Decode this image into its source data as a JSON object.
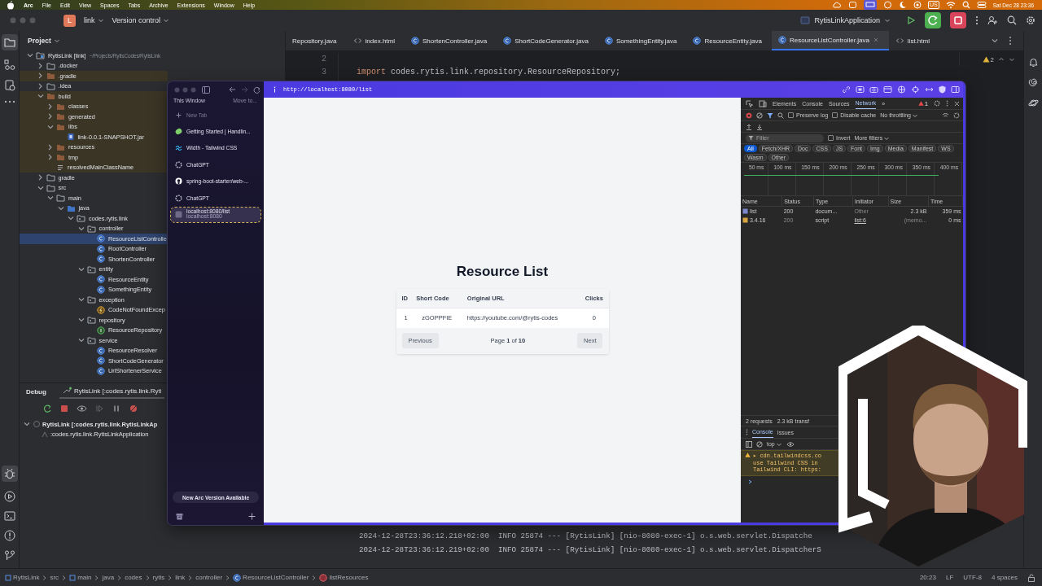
{
  "menu_bar": {
    "app": "Arc",
    "items": [
      "File",
      "Edit",
      "View",
      "Spaces",
      "Tabs",
      "Archive",
      "Extensions",
      "Window",
      "Help"
    ],
    "input_source": "US",
    "clock": "Sat Dec 28  23:36"
  },
  "ide_toolbar": {
    "project_badge": "L",
    "project": "link",
    "vcs": "Version control",
    "run_config": "RytisLinkApplication"
  },
  "project_panel": {
    "title": "Project",
    "tree": [
      {
        "label": "RytisLink [link]",
        "hint": "~/Projects/RytisCodes/RytisLink",
        "kind": "module",
        "expanded": true,
        "selected": false,
        "children": [
          {
            "label": ".docker",
            "kind": "folder",
            "expanded": false,
            "selected": false
          },
          {
            "label": ".gradle",
            "kind": "excluded-folder",
            "expanded": false,
            "selected": false
          },
          {
            "label": ".idea",
            "kind": "folder",
            "expanded": false,
            "selected": false
          },
          {
            "label": "build",
            "kind": "excluded-folder",
            "expanded": true,
            "selected": false,
            "children": [
              {
                "label": "classes",
                "kind": "excluded-folder",
                "expanded": false,
                "selected": false
              },
              {
                "label": "generated",
                "kind": "excluded-folder",
                "expanded": false,
                "selected": false
              },
              {
                "label": "libs",
                "kind": "excluded-folder",
                "expanded": true,
                "selected": false,
                "children": [
                  {
                    "label": "link-0.0.1-SNAPSHOT.jar",
                    "kind": "jar",
                    "selected": false
                  }
                ]
              },
              {
                "label": "resources",
                "kind": "excluded-folder",
                "expanded": false,
                "selected": false
              },
              {
                "label": "tmp",
                "kind": "excluded-folder",
                "expanded": false,
                "selected": false
              },
              {
                "label": "resolvedMainClassName",
                "kind": "file",
                "selected": false
              }
            ]
          },
          {
            "label": "gradle",
            "kind": "folder",
            "expanded": false,
            "selected": false
          },
          {
            "label": "src",
            "kind": "folder",
            "expanded": true,
            "selected": false,
            "children": [
              {
                "label": "main",
                "kind": "folder",
                "expanded": true,
                "selected": false,
                "children": [
                  {
                    "label": "java",
                    "kind": "source-folder",
                    "expanded": true,
                    "selected": false,
                    "children": [
                      {
                        "label": "codes.rytis.link",
                        "kind": "package",
                        "expanded": true,
                        "selected": false,
                        "children": [
                          {
                            "label": "controller",
                            "kind": "package",
                            "expanded": true,
                            "selected": false,
                            "children": [
                              {
                                "label": "ResourceListControlle",
                                "kind": "class",
                                "selected": true
                              },
                              {
                                "label": "RootController",
                                "kind": "class",
                                "selected": false
                              },
                              {
                                "label": "ShortenController",
                                "kind": "class",
                                "selected": false
                              }
                            ]
                          },
                          {
                            "label": "entity",
                            "kind": "package",
                            "expanded": true,
                            "selected": false,
                            "children": [
                              {
                                "label": "ResourceEntity",
                                "kind": "class",
                                "selected": false
                              },
                              {
                                "label": "SomethingEntity",
                                "kind": "class",
                                "selected": false
                              }
                            ]
                          },
                          {
                            "label": "exception",
                            "kind": "package",
                            "expanded": true,
                            "selected": false,
                            "children": [
                              {
                                "label": "CodeNotFoundExcep",
                                "kind": "exception",
                                "selected": false
                              }
                            ]
                          },
                          {
                            "label": "repository",
                            "kind": "package",
                            "expanded": true,
                            "selected": false,
                            "children": [
                              {
                                "label": "ResourceRepository",
                                "kind": "interface",
                                "selected": false
                              }
                            ]
                          },
                          {
                            "label": "service",
                            "kind": "package",
                            "expanded": true,
                            "selected": false,
                            "children": [
                              {
                                "label": "ResourceResolver",
                                "kind": "class",
                                "selected": false
                              },
                              {
                                "label": "ShortCodeGenerator",
                                "kind": "class",
                                "selected": false
                              },
                              {
                                "label": "UrlShortenerService",
                                "kind": "class",
                                "selected": false
                              }
                            ]
                          }
                        ]
                      }
                    ]
                  }
                ]
              }
            ]
          }
        ]
      }
    ]
  },
  "editor": {
    "tabs": [
      {
        "label": "Repository.java",
        "kind": "none",
        "selected": false
      },
      {
        "label": "index.html",
        "kind": "html",
        "selected": false
      },
      {
        "label": "ShortenController.java",
        "kind": "class",
        "selected": false
      },
      {
        "label": "ShortCodeGenerator.java",
        "kind": "class",
        "selected": false
      },
      {
        "label": "SomethingEntity.java",
        "kind": "class",
        "selected": false
      },
      {
        "label": "ResourceEntity.java",
        "kind": "class",
        "selected": false
      },
      {
        "label": "ResourceListController.java",
        "kind": "class",
        "selected": true
      },
      {
        "label": "list.html",
        "kind": "html",
        "selected": false
      }
    ],
    "lines": [
      {
        "number": "2"
      },
      {
        "number": "3",
        "tokens": [
          {
            "text": "import",
            "kind": "keyword"
          },
          {
            "text": " codes.rytis.link.repository.ResourceRepository",
            "kind": "plain"
          },
          {
            "text": ";",
            "kind": "punct"
          }
        ]
      }
    ],
    "warnings": "2"
  },
  "debug": {
    "title": "Debug",
    "session": "RytisLink [:codes.rytis.link.Ryti",
    "tree": [
      {
        "label": "RytisLink [:codes.rytis.link.RytisLinkAp",
        "expanded": true,
        "children": [
          {
            "label": ":codes.rytis.link.RytisLinkApplication"
          }
        ]
      }
    ]
  },
  "console": {
    "lines": [
      "2024-12-28T23:36:12.218+02:00  INFO 25874 --- [RytisLink] [nio-8080-exec-1] o.s.web.servlet.Dispatche",
      "2024-12-28T23:36:12.219+02:00  INFO 25874 --- [RytisLink] [nio-8080-exec-1] o.s.web.servlet.DispatcherS"
    ]
  },
  "status_bar": {
    "breadcrumbs": [
      {
        "label": "RytisLink",
        "kind": "module"
      },
      {
        "label": "src",
        "kind": "plain"
      },
      {
        "label": "main",
        "kind": "module"
      },
      {
        "label": "java",
        "kind": "plain"
      },
      {
        "label": "codes",
        "kind": "plain"
      },
      {
        "label": "rytis",
        "kind": "plain"
      },
      {
        "label": "link",
        "kind": "plain"
      },
      {
        "label": "controller",
        "kind": "plain"
      },
      {
        "label": "ResourceListController",
        "kind": "class"
      },
      {
        "label": "listResources",
        "kind": "method"
      }
    ],
    "position": "20:23",
    "line_separator": "LF",
    "encoding": "UTF-8",
    "indent": "4 spaces"
  },
  "browser": {
    "sidebar": {
      "window_label": "This Window",
      "move_hint": "Move to...",
      "new_tab": "New Tab",
      "tabs": [
        {
          "label": "Getting Started | Handlin...",
          "kind": "leaf",
          "selected": false
        },
        {
          "label": "Width - Tailwind CSS",
          "kind": "tailwind",
          "selected": false
        },
        {
          "label": "ChatGPT",
          "kind": "chatgpt",
          "selected": false
        },
        {
          "label": "spring-boot-starter/web-...",
          "kind": "github",
          "selected": false
        },
        {
          "label": "ChatGPT",
          "kind": "chatgpt",
          "selected": false
        },
        {
          "label": "localhost:8080/list",
          "subtitle": "localhost:8080",
          "kind": "page",
          "selected": true
        }
      ],
      "update_button": "New Arc Version Available"
    },
    "url": "http://localhost:8080/list",
    "page": {
      "title": "Resource List",
      "columns": [
        "ID",
        "Short Code",
        "Original URL",
        "Clicks"
      ],
      "rows": [
        [
          "1",
          "zGOPPFIE",
          "https://youtube.com/@rytis-codes",
          "0"
        ]
      ],
      "previous": "Previous",
      "page_info": "Page **1** of **10**",
      "next": "Next"
    },
    "devtools": {
      "tabs": [
        {
          "label": "Elements",
          "selected": false
        },
        {
          "label": "Console",
          "selected": false
        },
        {
          "label": "Sources",
          "selected": false
        },
        {
          "label": "Network",
          "selected": true
        }
      ],
      "more": "»",
      "warnings": "1",
      "preserve_log": {
        "label": "Preserve log",
        "checked": false
      },
      "disable_cache": {
        "label": "Disable cache",
        "checked": false
      },
      "throttling": "No throttling",
      "filter_placeholder": "Filter",
      "invert": {
        "label": "Invert",
        "checked": false
      },
      "more_filters": "More filters",
      "types": [
        {
          "label": "All",
          "selected": true
        },
        {
          "label": "Fetch/XHR",
          "selected": false
        },
        {
          "label": "Doc",
          "selected": false
        },
        {
          "label": "CSS",
          "selected": false
        },
        {
          "label": "JS",
          "selected": false
        },
        {
          "label": "Font",
          "selected": false
        },
        {
          "label": "Img",
          "selected": false
        },
        {
          "label": "Media",
          "selected": false
        },
        {
          "label": "Manifest",
          "selected": false
        },
        {
          "label": "WS",
          "selected": false
        },
        {
          "label": "Wasm",
          "selected": false
        },
        {
          "label": "Other",
          "selected": false
        }
      ],
      "timeline_ticks": [
        "50 ms",
        "100 ms",
        "150 ms",
        "200 ms",
        "250 ms",
        "300 ms",
        "350 ms",
        "400 ms"
      ],
      "columns": [
        "Name",
        "Status",
        "Type",
        "Initiator",
        "Size",
        "Time"
      ],
      "requests": [
        {
          "name": "list",
          "kind": "document",
          "status": "200",
          "type": "docum...",
          "initiator": "Other",
          "size": "2.3 kB",
          "time": "359 ms"
        },
        {
          "name": "3.4.16",
          "kind": "script",
          "status": "200",
          "type": "script",
          "initiator": "list:6",
          "size": "(memo...",
          "time": "0 ms"
        }
      ],
      "summary": [
        "2 requests",
        "2.3 kB transf"
      ],
      "drawer": {
        "tabs": [
          {
            "label": "Console",
            "selected": true
          },
          {
            "label": "Issues",
            "selected": false
          }
        ],
        "context": "top",
        "messages": [
          {
            "kind": "warning",
            "lines": [
              "▸ cdn.tailwindcss.co",
              "use Tailwind CSS in",
              "Tailwind CLI: https:"
            ]
          }
        ]
      }
    }
  }
}
